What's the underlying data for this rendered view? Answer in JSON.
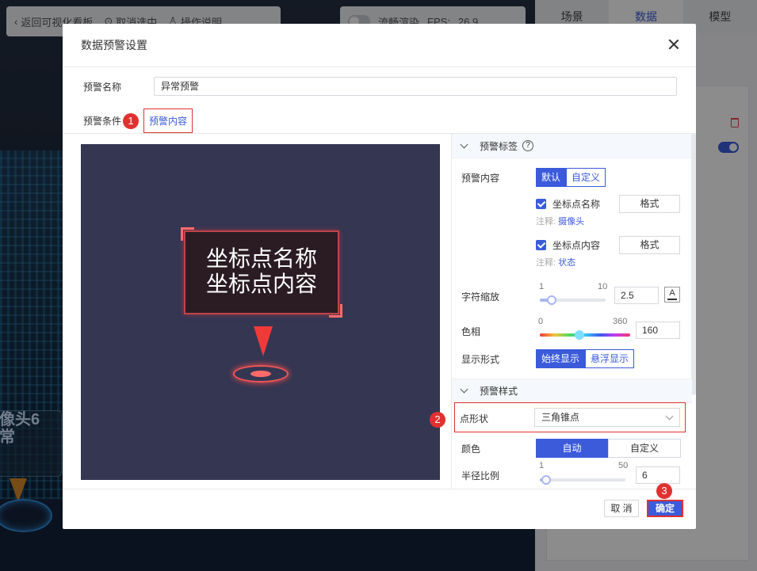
{
  "topbar": {
    "back_label": "返回可视化看板",
    "cancel_select_label": "取消选中",
    "help_label": "操作说明"
  },
  "fpsbar": {
    "render_label": "流畅渲染",
    "fps_label": "FPS:",
    "fps_value": "26.9"
  },
  "scene": {
    "label_line1": "像头6",
    "label_line2": "常"
  },
  "right_panel": {
    "tabs": [
      "场景",
      "数据",
      "模型"
    ],
    "active_tab": "数据"
  },
  "dialog": {
    "title": "数据预警设置",
    "name_label": "预警名称",
    "name_value": "异常预警",
    "subtab_condition": "预警条件",
    "subtab_content": "预警内容",
    "badges": [
      "1",
      "2",
      "3"
    ],
    "preview": {
      "line1": "坐标点名称",
      "line2": "坐标点内容"
    },
    "settings": {
      "section_label": "预警标签",
      "help_icon": "?",
      "content_label": "预警内容",
      "content_modes": [
        "默认",
        "自定义"
      ],
      "content_mode_selected": "默认",
      "checkbox_name": "坐标点名称",
      "format_label": "格式",
      "note_prefix": "注释:",
      "note_name": "摄像头",
      "checkbox_content": "坐标点内容",
      "note_content": "状态",
      "font_scale_label": "字符缩放",
      "font_scale_min": "1",
      "font_scale_max": "10",
      "font_scale_value": "2.5",
      "font_icon": "A",
      "hue_label": "色相",
      "hue_min": "0",
      "hue_max": "360",
      "hue_value": "160",
      "display_label": "显示形式",
      "display_modes": [
        "始终显示",
        "悬浮显示"
      ],
      "display_selected": "始终显示",
      "section_style_label": "预警样式",
      "shape_label": "点形状",
      "shape_value": "三角锥点",
      "color_label": "颜色",
      "color_modes": [
        "自动",
        "自定义"
      ],
      "color_selected": "自动",
      "radius_label": "半径比例",
      "radius_min": "1",
      "radius_max": "50",
      "radius_value": "6"
    },
    "cancel_label": "取 消",
    "ok_label": "确定"
  },
  "colors": {
    "accent": "#3b5bdb",
    "highlight": "#e03131"
  }
}
